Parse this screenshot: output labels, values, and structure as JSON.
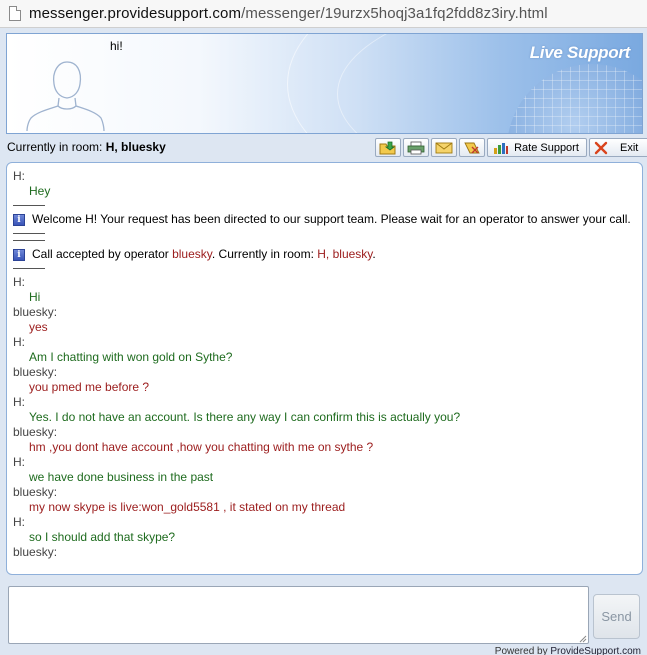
{
  "browser": {
    "url_host": "messenger.providesupport.com",
    "url_path": "/messenger/19urzx5hoqj3a1fq2fdd8z3iry.html"
  },
  "banner": {
    "greeting": "hi!",
    "brand": "Live Support"
  },
  "room": {
    "label": "Currently in room:",
    "people": "H, bluesky"
  },
  "toolbar": {
    "rate_label": "Rate Support",
    "exit_label": "Exit",
    "icons": [
      "save-transcript-icon",
      "print-icon",
      "email-icon",
      "clear-icon",
      "rate-icon",
      "exit-icon"
    ]
  },
  "chat": {
    "first": {
      "author": "H:",
      "text": "Hey"
    },
    "system1": "Welcome H! Your request has been directed to our support team. Please wait for an operator to answer your call.",
    "system2": {
      "prefix": "Call accepted by operator ",
      "operator": "bluesky",
      "middle": ". Currently in room: ",
      "room": "H, bluesky",
      "suffix": "."
    },
    "messages": [
      {
        "author": "H:",
        "text": "Hi",
        "role": "user"
      },
      {
        "author": "bluesky:",
        "text": "yes",
        "role": "op"
      },
      {
        "author": "H:",
        "text": "Am I chatting with won gold on Sythe?",
        "role": "user"
      },
      {
        "author": "bluesky:",
        "text": "you pmed me before ?",
        "role": "op"
      },
      {
        "author": "H:",
        "text": "Yes. I do not have an account. Is there any way I can confirm this is actually you?",
        "role": "user"
      },
      {
        "author": "bluesky:",
        "text": "hm ,you dont have account ,how you chatting with me on sythe  ?",
        "role": "op"
      },
      {
        "author": "H:",
        "text": "we have done business in the past",
        "role": "user"
      },
      {
        "author": "bluesky:",
        "text": "my now skype is live:won_gold5581 , it stated on my thread",
        "role": "op"
      },
      {
        "author": "H:",
        "text": "so I should add that skype?",
        "role": "user"
      },
      {
        "author": "bluesky:",
        "text": "",
        "role": "op"
      }
    ]
  },
  "compose": {
    "value": "",
    "send_label": "Send"
  },
  "footer": {
    "powered_prefix": "Powered by ",
    "powered_link": "ProvideSupport.com"
  }
}
